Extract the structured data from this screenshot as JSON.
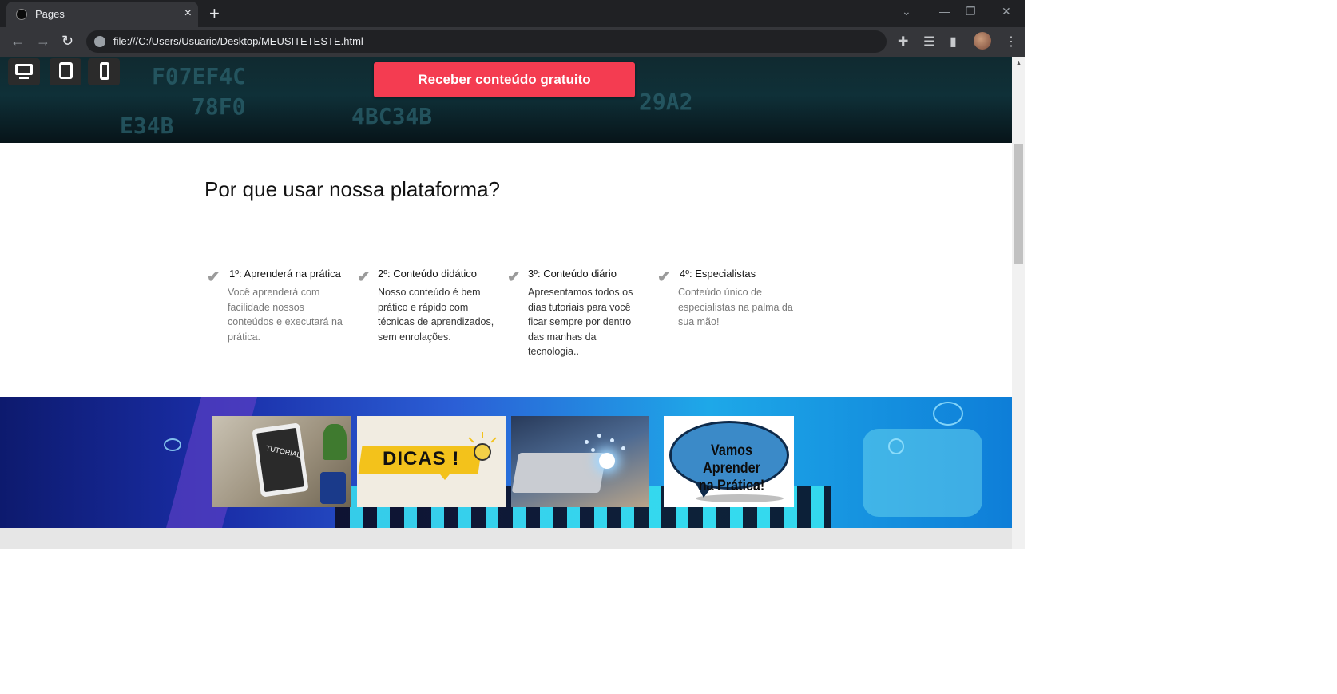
{
  "browser": {
    "tab_title": "Pages",
    "tab_close": "×",
    "new_tab": "+",
    "url": "file:///C:/Users/Usuario/Desktop/MEUSITETESTE.html",
    "icons": {
      "back": "arrow-left-icon",
      "forward": "arrow-right-icon",
      "reload": "reload-icon",
      "site_info": "globe-icon",
      "extensions": "puzzle-icon",
      "reading_list": "reading-list-icon",
      "side_panel": "side-panel-icon",
      "menu": "kebab-menu-icon"
    }
  },
  "preview_devices": [
    "desktop-icon",
    "tablet-icon",
    "mobile-icon"
  ],
  "hero": {
    "cta_label": "Receber conteúdo gratuito"
  },
  "features_section": {
    "title": "Por que usar nossa plataforma?",
    "items": [
      {
        "title": "1º: Aprenderá na prática",
        "text": "Você aprenderá com facilidade nossos conteúdos e executará na prática."
      },
      {
        "title": "2º: Conteúdo didático",
        "text": "Nosso conteúdo é bem prático e rápido com técnicas de aprendizados, sem enrolações."
      },
      {
        "title": "3º: Conteúdo diário",
        "text": "Apresentamos todos os dias tutoriais para você ficar sempre por dentro das manhas da tecnologia.."
      },
      {
        "title": "4º: Especialistas",
        "text": "Conteúdo único de especialistas na palma da sua mão!"
      }
    ]
  },
  "gallery": {
    "items": [
      {
        "label": "TUTORIAL"
      },
      {
        "label": "DICAS !"
      },
      {
        "label": ""
      },
      {
        "label_line1": "Vamos Aprender",
        "label_line2": "na Prática!"
      }
    ]
  },
  "colors": {
    "cta": "#f43c51",
    "browser_frame": "#202124",
    "toolbar": "#35363a"
  }
}
